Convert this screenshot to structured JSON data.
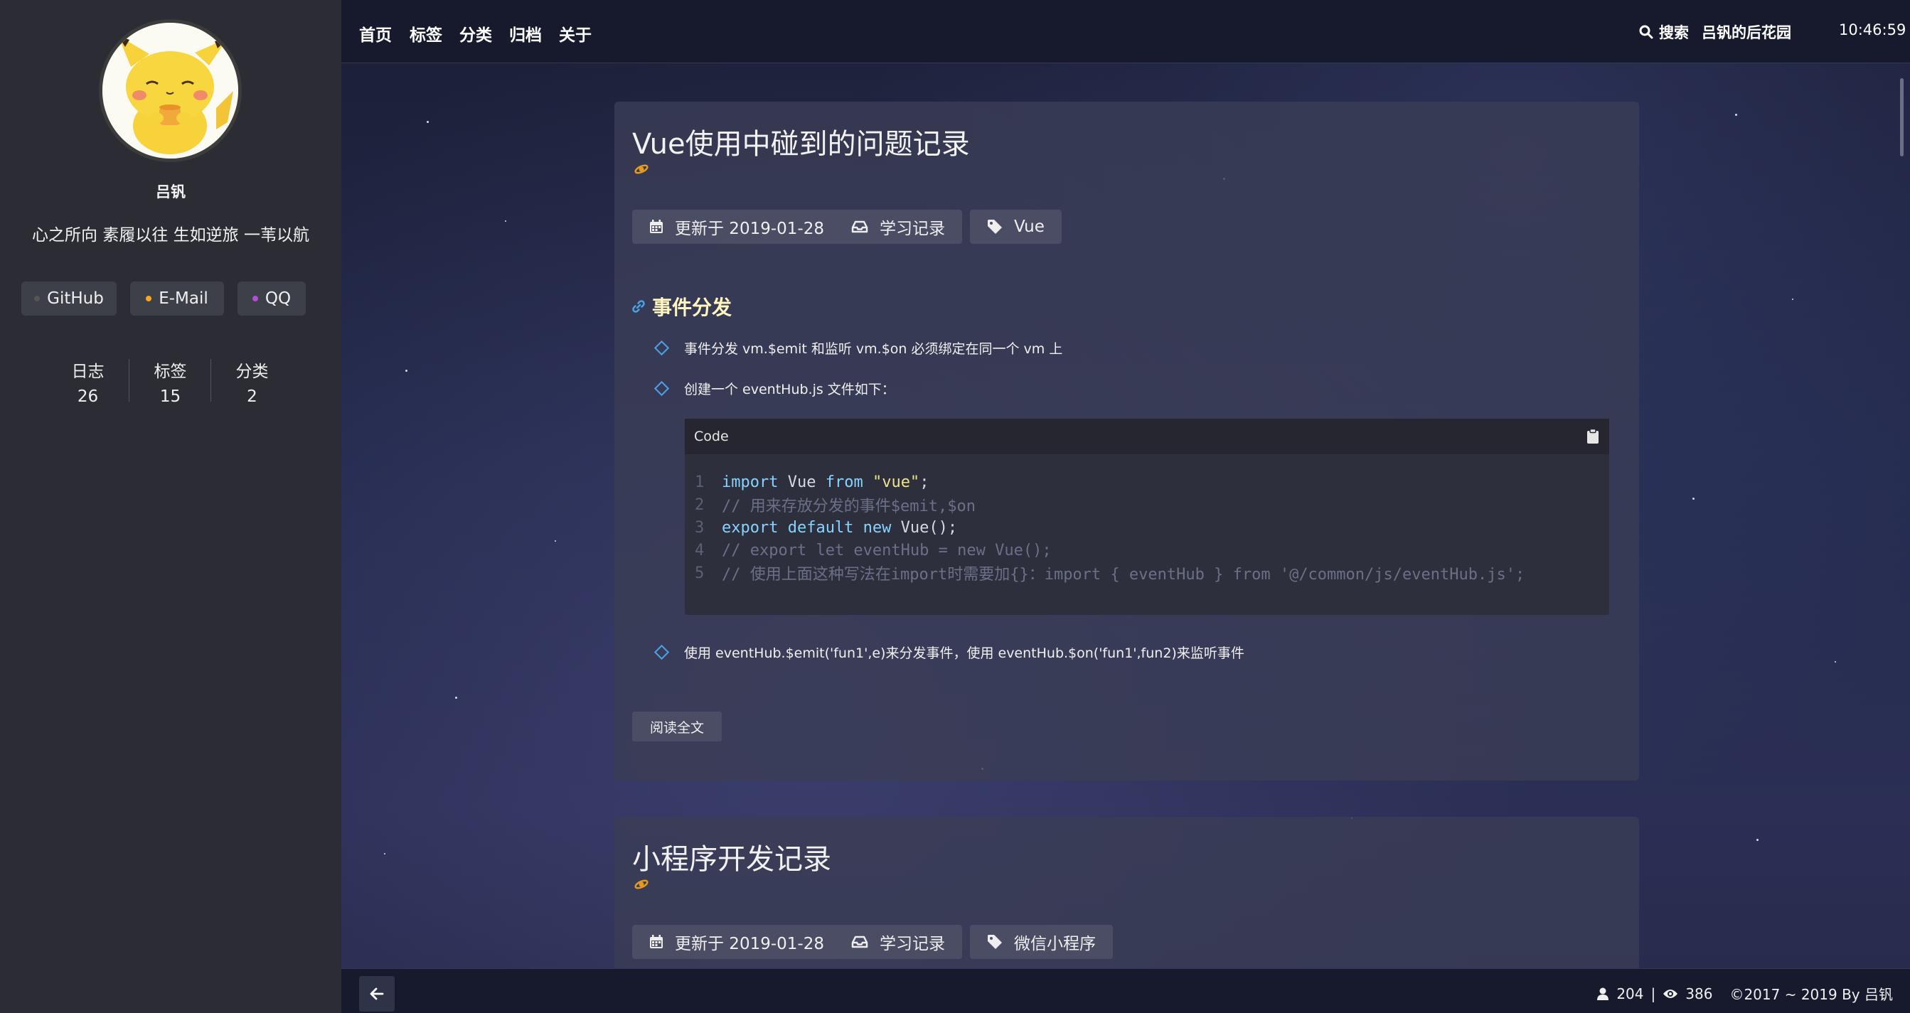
{
  "sidebar": {
    "author_name": "吕钒",
    "motto": "心之所向 素履以往 生如逆旅 一苇以航",
    "social": [
      {
        "label": "GitHub",
        "dot_color": "#555555"
      },
      {
        "label": "E-Mail",
        "dot_color": "#f6a623"
      },
      {
        "label": "QQ",
        "dot_color": "#b04fd6"
      }
    ],
    "stats": [
      {
        "label": "日志",
        "value": "26"
      },
      {
        "label": "标签",
        "value": "15"
      },
      {
        "label": "分类",
        "value": "2"
      }
    ]
  },
  "nav": {
    "items": [
      "首页",
      "标签",
      "分类",
      "归档",
      "关于"
    ],
    "search_label": "搜索",
    "site_name": "吕钒的后花园",
    "clock": "10:46:59"
  },
  "posts": [
    {
      "title": "Vue使用中碰到的问题记录",
      "updated": "更新于 2019-01-28",
      "category": "学习记录",
      "tag": "Vue",
      "section_heading": "事件分发",
      "items": [
        "事件分发 vm.$emit 和监听 vm.$on 必须绑定在同一个 vm 上",
        "创建一个 eventHub.js 文件如下：",
        "使用 eventHub.$emit('fun1',e)来分发事件，使用 eventHub.$on('fun1',fun2)来监听事件"
      ],
      "code_label": "Code",
      "code": [
        {
          "n": "1",
          "parts": [
            [
              "kw",
              "import"
            ],
            [
              "tx",
              " Vue "
            ],
            [
              "kw",
              "from"
            ],
            [
              "tx",
              " "
            ],
            [
              "str",
              "\"vue\""
            ],
            [
              "tx",
              ";"
            ]
          ]
        },
        {
          "n": "2",
          "parts": [
            [
              "cm",
              "// 用来存放分发的事件$emit,$on"
            ]
          ]
        },
        {
          "n": "3",
          "parts": [
            [
              "kw",
              "export default new"
            ],
            [
              "tx",
              " Vue();"
            ]
          ]
        },
        {
          "n": "4",
          "parts": [
            [
              "cm",
              "// export let eventHub = new Vue();"
            ]
          ]
        },
        {
          "n": "5",
          "parts": [
            [
              "cm",
              "// 使用上面这种写法在import时需要加{}：import { eventHub } from '@/common/js/eventHub.js';"
            ]
          ]
        }
      ],
      "read_more": "阅读全文"
    },
    {
      "title": "小程序开发记录",
      "updated": "更新于 2019-01-28",
      "category": "学习记录",
      "tag": "微信小程序"
    }
  ],
  "footer": {
    "visitors": "204",
    "separator": "|",
    "views": "386",
    "copyright": "©2017 ~ 2019 By 吕钒"
  },
  "colors": {
    "accent_blue": "#4aa3e8",
    "heading_yellow": "#fff6c0",
    "icon_orange": "#e39a1e"
  }
}
